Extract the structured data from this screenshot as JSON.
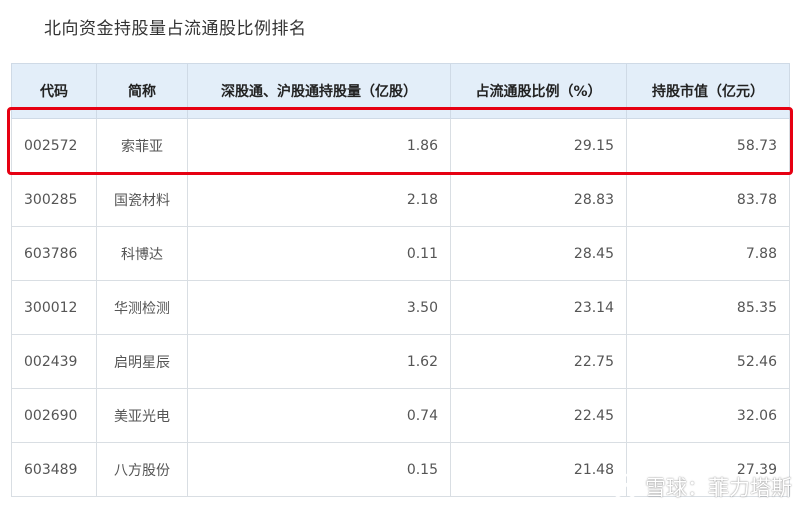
{
  "title": "北向资金持股量占流通股比例排名",
  "table": {
    "columns": [
      "代码",
      "简称",
      "深股通、沪股通持股量（亿股）",
      "占流通股比例（%）",
      "持股市值（亿元）"
    ],
    "rows": [
      {
        "code": "002572",
        "name": "索菲亚",
        "shares": "1.86",
        "ratio": "29.15",
        "value": "58.73"
      },
      {
        "code": "300285",
        "name": "国瓷材料",
        "shares": "2.18",
        "ratio": "28.83",
        "value": "83.78"
      },
      {
        "code": "603786",
        "name": "科博达",
        "shares": "0.11",
        "ratio": "28.45",
        "value": "7.88"
      },
      {
        "code": "300012",
        "name": "华测检测",
        "shares": "3.50",
        "ratio": "23.14",
        "value": "85.35"
      },
      {
        "code": "002439",
        "name": "启明星辰",
        "shares": "1.62",
        "ratio": "22.75",
        "value": "52.46"
      },
      {
        "code": "002690",
        "name": "美亚光电",
        "shares": "0.74",
        "ratio": "22.45",
        "value": "32.06"
      },
      {
        "code": "603489",
        "name": "八方股份",
        "shares": "0.15",
        "ratio": "21.48",
        "value": "27.39"
      }
    ]
  },
  "watermark": {
    "text": "雪球：菲力塔斯",
    "icon": "snowball-logo"
  },
  "colors": {
    "header_bg": "#e3eef9",
    "highlight": "#e60012"
  }
}
